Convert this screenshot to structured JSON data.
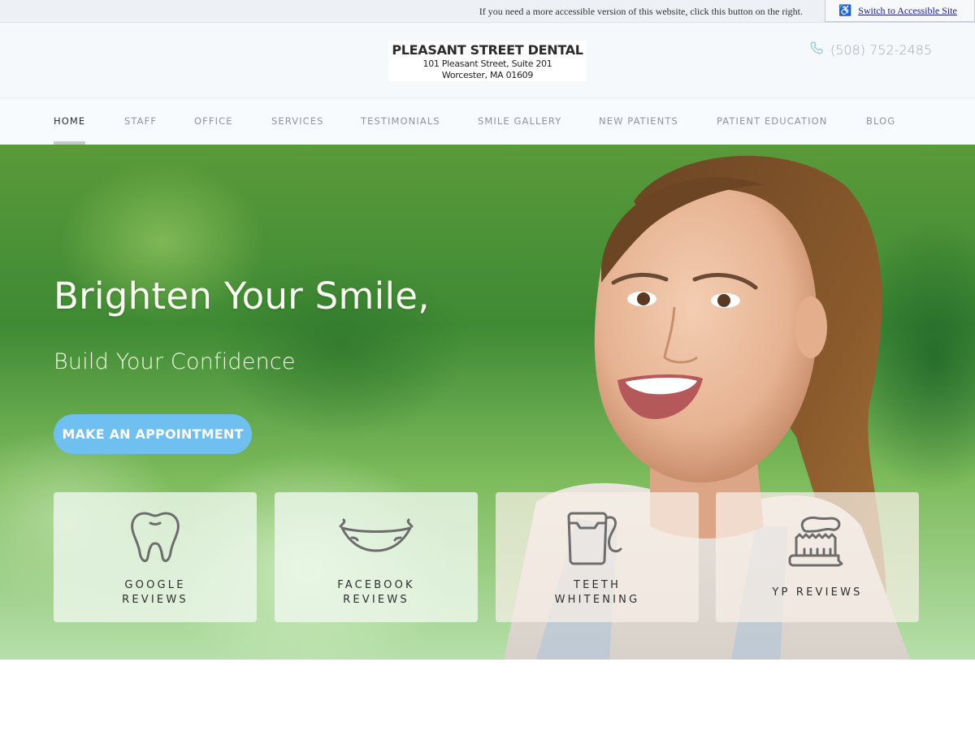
{
  "accessibility": {
    "notice": "If you need a more accessible version of this website, click this button on the right.",
    "button_label": "Switch to Accessible Site",
    "button_icon": "wheelchair-icon"
  },
  "header": {
    "logo": {
      "name": "PLEASANT STREET DENTAL",
      "address_line1": "101 Pleasant Street, Suite 201",
      "address_line2": "Worcester, MA 01609"
    },
    "phone": {
      "icon": "phone-icon",
      "number": "(508) 752-2485"
    }
  },
  "nav": {
    "active": "HOME",
    "items": [
      {
        "label": "HOME"
      },
      {
        "label": "STAFF"
      },
      {
        "label": "OFFICE"
      },
      {
        "label": "SERVICES"
      },
      {
        "label": "TESTIMONIALS"
      },
      {
        "label": "SMILE GALLERY"
      },
      {
        "label": "NEW PATIENTS"
      },
      {
        "label": "PATIENT EDUCATION"
      },
      {
        "label": "BLOG"
      }
    ]
  },
  "hero": {
    "title": "Brighten Your Smile,",
    "subtitle": "Build Your Confidence",
    "cta_label": "MAKE AN APPOINTMENT",
    "cta_color": "#6fbff0",
    "cards": [
      {
        "icon": "tooth-icon",
        "line1": "GOOGLE",
        "line2": "REVIEWS"
      },
      {
        "icon": "smile-icon",
        "line1": "FACEBOOK",
        "line2": "REVIEWS"
      },
      {
        "icon": "floss-icon",
        "line1": "TEETH",
        "line2": "WHITENING"
      },
      {
        "icon": "toothbrush-icon",
        "line1": "YP REVIEWS"
      }
    ]
  }
}
